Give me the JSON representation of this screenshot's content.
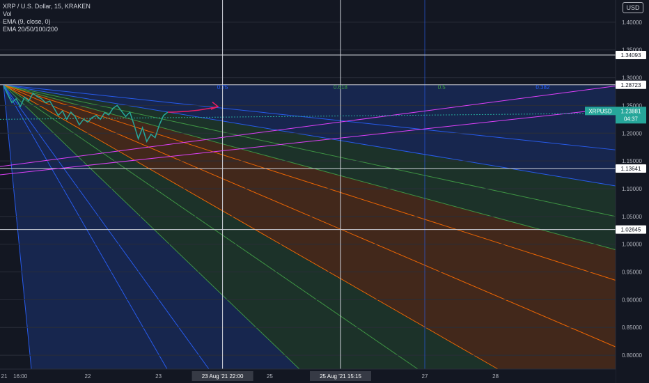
{
  "legend": {
    "title": "XRP / U.S. Dollar, 15, KRAKEN",
    "vol": "Vol",
    "ema_single": "EMA (9, close, 0)",
    "ema_multi": "EMA 20/50/100/200"
  },
  "currency_button": "USD",
  "symbol_tag": "XRPUSD",
  "colors": {
    "background": "#131722",
    "axis_text": "#b2b5be",
    "price_tag": "#26a69a",
    "arrow": "#e91e63",
    "fan_blue": "#2962ff",
    "fan_green": "#43a047",
    "fan_orange": "#ff6d00",
    "ema_line": "#e040fb"
  },
  "chart_data": {
    "type": "line",
    "symbol": "XRPUSD",
    "last_price": 1.23881,
    "countdown": "04:37",
    "ylim": [
      0.775,
      1.44
    ],
    "y_ticks": [
      "1.40000",
      "1.35000",
      "1.30000",
      "1.25000",
      "1.20000",
      "1.15000",
      "1.10000",
      "1.05000",
      "1.00000",
      "0.95000",
      "0.90000",
      "0.85000",
      "0.80000"
    ],
    "y_tick_values": [
      1.4,
      1.35,
      1.3,
      1.25,
      1.2,
      1.15,
      1.1,
      1.05,
      1.0,
      0.95,
      0.9,
      0.85,
      0.8
    ],
    "x_ticks": [
      {
        "label": "21",
        "pos": 0.0
      },
      {
        "label": "16:00",
        "pos": 0.2
      },
      {
        "label": "22",
        "pos": 1.0
      },
      {
        "label": "23",
        "pos": 1.84
      },
      {
        "label": "25",
        "pos": 3.16
      },
      {
        "label": "27",
        "pos": 5.0
      },
      {
        "label": "28",
        "pos": 5.84
      }
    ],
    "x_highlight_labels": [
      {
        "label": "23 Aug '21  22:00",
        "pos": 2.6
      },
      {
        "label": "25 Aug '21  15:15",
        "pos": 4.0
      }
    ],
    "horizontal_levels": [
      {
        "label": "1.34093",
        "value": 1.34093
      },
      {
        "label": "1.28723",
        "value": 1.28723
      },
      {
        "label": "1.13641",
        "value": 1.13641
      },
      {
        "label": "1.02645",
        "value": 1.02645
      }
    ],
    "fib_labels": [
      {
        "label": "0.75",
        "pos": 2.6
      },
      {
        "label": "0.618",
        "pos": 4.0
      },
      {
        "label": "0.5",
        "pos": 5.2
      },
      {
        "label": "0.382",
        "pos": 6.4
      }
    ],
    "price_series": [
      [
        0.0,
        1.285
      ],
      [
        0.05,
        1.27
      ],
      [
        0.1,
        1.255
      ],
      [
        0.15,
        1.262
      ],
      [
        0.2,
        1.248
      ],
      [
        0.25,
        1.265
      ],
      [
        0.3,
        1.258
      ],
      [
        0.35,
        1.272
      ],
      [
        0.4,
        1.266
      ],
      [
        0.45,
        1.262
      ],
      [
        0.5,
        1.255
      ],
      [
        0.55,
        1.258
      ],
      [
        0.6,
        1.245
      ],
      [
        0.65,
        1.232
      ],
      [
        0.7,
        1.24
      ],
      [
        0.75,
        1.225
      ],
      [
        0.8,
        1.238
      ],
      [
        0.85,
        1.23
      ],
      [
        0.9,
        1.215
      ],
      [
        0.95,
        1.225
      ],
      [
        1.0,
        1.22
      ],
      [
        1.05,
        1.228
      ],
      [
        1.1,
        1.232
      ],
      [
        1.15,
        1.225
      ],
      [
        1.2,
        1.237
      ],
      [
        1.25,
        1.233
      ],
      [
        1.3,
        1.245
      ],
      [
        1.35,
        1.25
      ],
      [
        1.4,
        1.24
      ],
      [
        1.45,
        1.23
      ],
      [
        1.5,
        1.238
      ],
      [
        1.55,
        1.215
      ],
      [
        1.6,
        1.19
      ],
      [
        1.65,
        1.21
      ],
      [
        1.7,
        1.185
      ],
      [
        1.75,
        1.198
      ],
      [
        1.8,
        1.192
      ],
      [
        1.85,
        1.215
      ],
      [
        1.9,
        1.232
      ],
      [
        1.95,
        1.238
      ]
    ]
  }
}
